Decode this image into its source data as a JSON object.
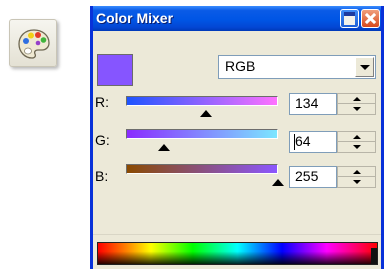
{
  "window": {
    "title": "Color Mixer"
  },
  "color_model": {
    "selected": "RGB"
  },
  "current_color": "#8655ff",
  "channels": [
    {
      "label": "R:",
      "value": "134",
      "gradient": [
        "#1e54ff",
        "#ff72ff"
      ],
      "fraction": 0.5255
    },
    {
      "label": "G:",
      "value": "64",
      "gradient": [
        "#8a2bff",
        "#7ce6ff"
      ],
      "fraction": 0.251
    },
    {
      "label": "B:",
      "value": "255",
      "gradient": [
        "#8a4a00",
        "#8b57ff"
      ],
      "fraction": 1.0
    }
  ],
  "icons": {
    "dock": "palette-icon",
    "minimize": "minimize-icon",
    "close": "close-icon"
  }
}
